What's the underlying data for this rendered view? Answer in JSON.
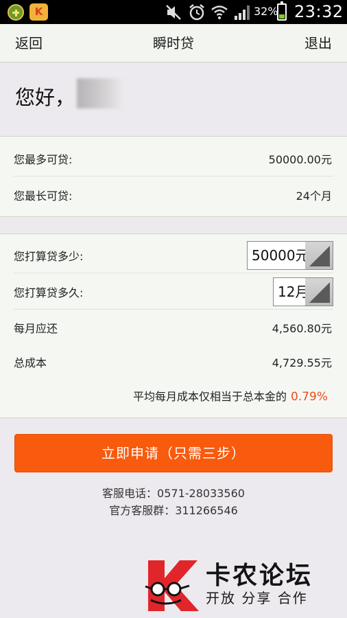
{
  "statusbar": {
    "app_icon_2_text": "K",
    "battery_percent": "32%",
    "battery_level": 0.32,
    "time": "23:32",
    "icons": [
      "mute-icon",
      "alarm-icon",
      "wifi-icon",
      "signal-icon",
      "battery-icon"
    ]
  },
  "header": {
    "back": "返回",
    "title": "瞬时贷",
    "exit": "退出",
    "background": "#f3f6f0"
  },
  "greeting": {
    "text": "您好，"
  },
  "limits": {
    "max_amount_label": "您最多可贷:",
    "max_amount_value": "50000.00元",
    "max_term_label": "您最长可贷:",
    "max_term_value": "24个月"
  },
  "calculator": {
    "amount_label": "您打算贷多少:",
    "amount_value": "50000元",
    "term_label": "您打算贷多久:",
    "term_value": "12月",
    "monthly_label": "每月应还",
    "monthly_value": "4,560.80元",
    "total_label": "总成本",
    "total_value": "4,729.55元",
    "ratio_text": "平均每月成本仅相当于总本金的",
    "ratio_value": "0.79%",
    "ratio_color": "#ee4b1c"
  },
  "apply_button": {
    "label": "立即申请（只需三步）",
    "color": "#f85a0e"
  },
  "contact": {
    "phone": "客服电话：0571-28033560",
    "group": "官方客服群：311266546"
  },
  "watermark": {
    "title": "卡农论坛",
    "subtitle": "开放 分享 合作"
  }
}
